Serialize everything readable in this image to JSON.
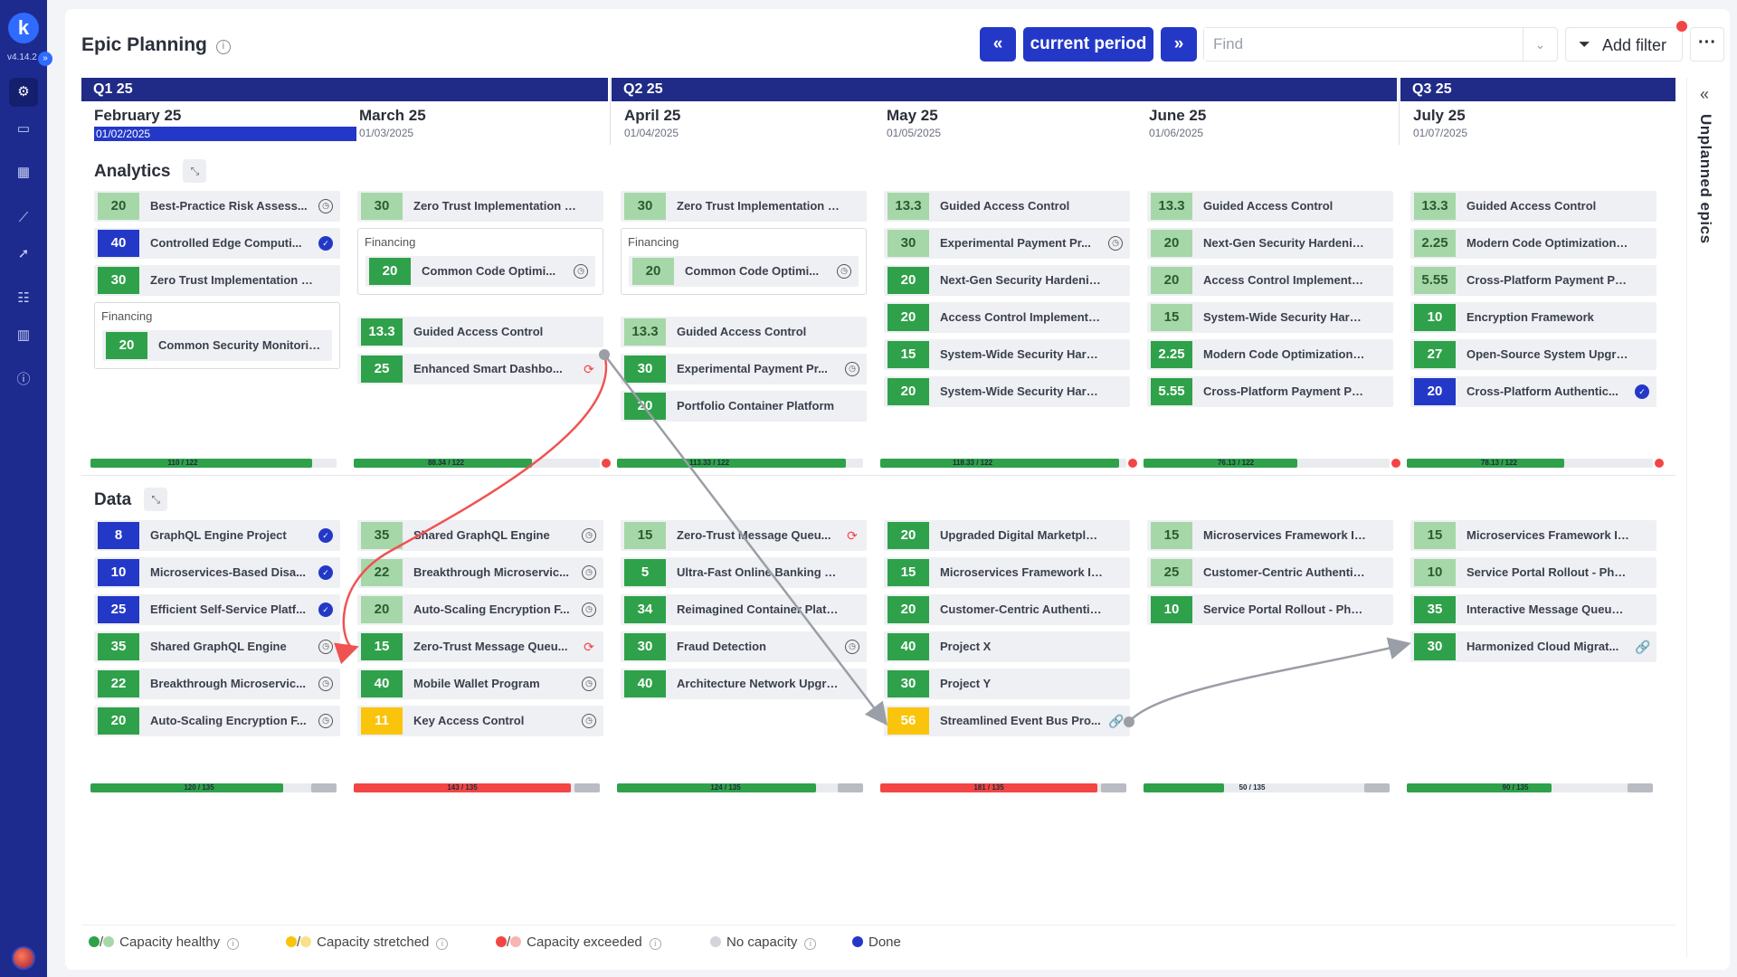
{
  "nav": {
    "logo": "k",
    "version": "v4.14.2",
    "collapse": "»",
    "items": [
      {
        "icon": "roadmap-icon"
      },
      {
        "icon": "briefcase-icon"
      },
      {
        "icon": "calendar-icon"
      },
      {
        "icon": "chart-icon"
      },
      {
        "icon": "rocket-icon"
      },
      {
        "icon": "team-icon"
      },
      {
        "icon": "building-icon"
      },
      {
        "icon": "info-icon"
      }
    ]
  },
  "header": {
    "title": "Epic Planning",
    "prev": "«",
    "current": "current period",
    "next": "»",
    "find_placeholder": "Find",
    "add_filter": "Add filter",
    "more": "···"
  },
  "quarters": [
    {
      "label": "Q1 25"
    },
    {
      "label": "Q2 25"
    },
    {
      "label": "Q3 25"
    }
  ],
  "months": [
    {
      "name": "February 25",
      "date": "01/02/2025",
      "current": true
    },
    {
      "name": "March 25",
      "date": "01/03/2025"
    },
    {
      "name": "April 25",
      "date": "01/04/2025"
    },
    {
      "name": "May 25",
      "date": "01/05/2025"
    },
    {
      "name": "June 25",
      "date": "01/06/2025"
    },
    {
      "name": "July 25",
      "date": "01/07/2025"
    }
  ],
  "sections": [
    {
      "title": "Analytics",
      "columns": [
        {
          "items": [
            {
              "pts": "20",
              "name": "Best-Practice Risk Assess...",
              "color": "lgreen",
              "icon": "clock"
            },
            {
              "pts": "40",
              "name": "Controlled Edge Computi...",
              "color": "blue",
              "icon": "done"
            },
            {
              "pts": "30",
              "name": "Zero Trust Implementation Roll...",
              "color": "green",
              "icon": ""
            },
            {
              "group": "Financing",
              "pts": "20",
              "name": "Common Security Monitoring",
              "color": "green",
              "icon": ""
            }
          ],
          "capacity": {
            "label": "110 / 122",
            "used": 110,
            "total": 122,
            "state": "healthy"
          }
        },
        {
          "items": [
            {
              "pts": "30",
              "name": "Zero Trust Implementation Roll...",
              "color": "lgreen",
              "icon": ""
            },
            {
              "group": "Financing",
              "pts": "20",
              "name": "Common Code Optimi...",
              "color": "green",
              "icon": "clock"
            },
            {
              "pts": "13.3",
              "name": "Guided Access Control",
              "color": "green",
              "icon": ""
            },
            {
              "pts": "25",
              "name": "Enhanced Smart Dashbo...",
              "color": "green",
              "icon": "cycle"
            }
          ],
          "capacity": {
            "label": "88.34 / 122",
            "used": 88.34,
            "total": 122,
            "state": "healthy",
            "alert": true
          }
        },
        {
          "items": [
            {
              "pts": "30",
              "name": "Zero Trust Implementation Roll...",
              "color": "lgreen",
              "icon": ""
            },
            {
              "group": "Financing",
              "pts": "20",
              "name": "Common Code Optimi...",
              "color": "lgreen",
              "icon": "clock"
            },
            {
              "pts": "13.3",
              "name": "Guided Access Control",
              "color": "lgreen",
              "icon": ""
            },
            {
              "pts": "30",
              "name": "Experimental Payment Pr...",
              "color": "green",
              "icon": "clock"
            },
            {
              "pts": "20",
              "name": "Portfolio Container Platform",
              "color": "green",
              "icon": ""
            }
          ],
          "capacity": {
            "label": "113.33 / 122",
            "used": 113.33,
            "total": 122,
            "state": "healthy"
          }
        },
        {
          "items": [
            {
              "pts": "13.3",
              "name": "Guided Access Control",
              "color": "lgreen",
              "icon": ""
            },
            {
              "pts": "30",
              "name": "Experimental Payment Pr...",
              "color": "lgreen",
              "icon": "clock"
            },
            {
              "pts": "20",
              "name": "Next-Gen Security Hardening ...",
              "color": "green",
              "icon": ""
            },
            {
              "pts": "20",
              "name": "Access Control Implementation",
              "color": "green",
              "icon": ""
            },
            {
              "pts": "15",
              "name": "System-Wide Security Hardeni...",
              "color": "green",
              "icon": ""
            },
            {
              "pts": "20",
              "name": "System-Wide Security Hardeni...",
              "color": "green",
              "icon": ""
            }
          ],
          "capacity": {
            "label": "118.33 / 122",
            "used": 118.33,
            "total": 122,
            "state": "healthy",
            "alert": true
          }
        },
        {
          "items": [
            {
              "pts": "13.3",
              "name": "Guided Access Control",
              "color": "lgreen",
              "icon": ""
            },
            {
              "pts": "20",
              "name": "Next-Gen Security Hardening ...",
              "color": "lgreen",
              "icon": ""
            },
            {
              "pts": "20",
              "name": "Access Control Implementation",
              "color": "lgreen",
              "icon": ""
            },
            {
              "pts": "15",
              "name": "System-Wide Security Hardeni...",
              "color": "lgreen",
              "icon": ""
            },
            {
              "pts": "2.25",
              "name": "Modern Code Optimization Fr...",
              "color": "green",
              "icon": ""
            },
            {
              "pts": "5.55",
              "name": "Cross-Platform Payment Proce...",
              "color": "green",
              "icon": ""
            }
          ],
          "capacity": {
            "label": "76.13 / 122",
            "used": 76.13,
            "total": 122,
            "state": "healthy",
            "alert": true
          }
        },
        {
          "items": [
            {
              "pts": "13.3",
              "name": "Guided Access Control",
              "color": "lgreen",
              "icon": ""
            },
            {
              "pts": "2.25",
              "name": "Modern Code Optimization Fr...",
              "color": "lgreen",
              "icon": ""
            },
            {
              "pts": "5.55",
              "name": "Cross-Platform Payment Proce...",
              "color": "lgreen",
              "icon": ""
            },
            {
              "pts": "10",
              "name": "Encryption Framework",
              "color": "green",
              "icon": ""
            },
            {
              "pts": "27",
              "name": "Open-Source System Upgrade",
              "color": "green",
              "icon": ""
            },
            {
              "pts": "20",
              "name": "Cross-Platform Authentic...",
              "color": "blue",
              "icon": "done"
            }
          ],
          "capacity": {
            "label": "78.13 / 122",
            "used": 78.13,
            "total": 122,
            "state": "healthy",
            "alert": true
          }
        }
      ]
    },
    {
      "title": "Data",
      "columns": [
        {
          "items": [
            {
              "pts": "8",
              "name": "GraphQL Engine Project",
              "color": "blue",
              "icon": "done"
            },
            {
              "pts": "10",
              "name": "Microservices-Based Disa...",
              "color": "blue",
              "icon": "done"
            },
            {
              "pts": "25",
              "name": "Efficient Self-Service Platf...",
              "color": "blue",
              "icon": "done"
            },
            {
              "pts": "35",
              "name": "Shared GraphQL Engine",
              "color": "green",
              "icon": "clock"
            },
            {
              "pts": "22",
              "name": "Breakthrough Microservic...",
              "color": "green",
              "icon": "clock"
            },
            {
              "pts": "20",
              "name": "Auto-Scaling Encryption F...",
              "color": "green",
              "icon": "clock"
            }
          ],
          "capacity": {
            "label": "120 / 135",
            "used": 120,
            "total": 135,
            "state": "healthy",
            "grey": true
          }
        },
        {
          "items": [
            {
              "pts": "35",
              "name": "Shared GraphQL Engine",
              "color": "lgreen",
              "icon": "clock"
            },
            {
              "pts": "22",
              "name": "Breakthrough Microservic...",
              "color": "lgreen",
              "icon": "clock"
            },
            {
              "pts": "20",
              "name": "Auto-Scaling Encryption F...",
              "color": "lgreen",
              "icon": "clock"
            },
            {
              "pts": "15",
              "name": "Zero-Trust Message Queu...",
              "color": "green",
              "icon": "cycle"
            },
            {
              "pts": "40",
              "name": "Mobile Wallet Program",
              "color": "green",
              "icon": "clock"
            },
            {
              "pts": "11",
              "name": "Key Access Control",
              "color": "yellow",
              "icon": "clock"
            }
          ],
          "capacity": {
            "label": "143 / 135",
            "used": 143,
            "total": 135,
            "state": "exceeded",
            "grey": true
          }
        },
        {
          "items": [
            {
              "pts": "15",
              "name": "Zero-Trust Message Queu...",
              "color": "lgreen",
              "icon": "cycle"
            },
            {
              "pts": "5",
              "name": "Ultra-Fast Online Banking Hub ...",
              "color": "green",
              "icon": ""
            },
            {
              "pts": "34",
              "name": "Reimagined Container Platfor...",
              "color": "green",
              "icon": ""
            },
            {
              "pts": "30",
              "name": "Fraud Detection",
              "color": "green",
              "icon": "clock"
            },
            {
              "pts": "40",
              "name": "Architecture Network Upgrad...",
              "color": "green",
              "icon": ""
            }
          ],
          "capacity": {
            "label": "124 / 135",
            "used": 124,
            "total": 135,
            "state": "healthy",
            "grey": true
          }
        },
        {
          "items": [
            {
              "pts": "20",
              "name": "Upgraded Digital Marketplac...",
              "color": "green",
              "icon": ""
            },
            {
              "pts": "15",
              "name": "Microservices Framework Initi...",
              "color": "green",
              "icon": ""
            },
            {
              "pts": "20",
              "name": "Customer-Centric Authenticat...",
              "color": "green",
              "icon": ""
            },
            {
              "pts": "40",
              "name": "Project X",
              "color": "green",
              "icon": ""
            },
            {
              "pts": "30",
              "name": "Project Y",
              "color": "green",
              "icon": ""
            },
            {
              "pts": "56",
              "name": "Streamlined Event Bus Pro...",
              "color": "yellow",
              "icon": "link"
            }
          ],
          "capacity": {
            "label": "181 / 135",
            "used": 181,
            "total": 135,
            "state": "exceeded",
            "grey": true
          }
        },
        {
          "items": [
            {
              "pts": "15",
              "name": "Microservices Framework Initi...",
              "color": "lgreen",
              "icon": ""
            },
            {
              "pts": "25",
              "name": "Customer-Centric Authenticat...",
              "color": "lgreen",
              "icon": ""
            },
            {
              "pts": "10",
              "name": "Service Portal Rollout - Phase 1",
              "color": "green",
              "icon": ""
            }
          ],
          "capacity": {
            "label": "50 / 135",
            "used": 50,
            "total": 135,
            "state": "healthy",
            "grey": true
          }
        },
        {
          "items": [
            {
              "pts": "15",
              "name": "Microservices Framework Initi...",
              "color": "lgreen",
              "icon": ""
            },
            {
              "pts": "10",
              "name": "Service Portal Rollout - Phase 1",
              "color": "lgreen",
              "icon": ""
            },
            {
              "pts": "35",
              "name": "Interactive Message Queue Pr...",
              "color": "green",
              "icon": ""
            },
            {
              "pts": "30",
              "name": "Harmonized Cloud Migrat...",
              "color": "green",
              "icon": "link"
            }
          ],
          "capacity": {
            "label": "90 / 135",
            "used": 90,
            "total": 135,
            "state": "healthy",
            "grey": true
          }
        }
      ]
    }
  ],
  "right_panel": {
    "label": "Unplanned epics",
    "chevron": "«"
  },
  "legend": [
    {
      "label": "Capacity healthy",
      "colors": [
        "#2fa14a",
        "#a6d7a8"
      ]
    },
    {
      "label": "Capacity stretched",
      "colors": [
        "#f9c40b",
        "#fbe08a"
      ]
    },
    {
      "label": "Capacity exceeded",
      "colors": [
        "#f44545",
        "#f9b3b3"
      ]
    },
    {
      "label": "No capacity",
      "colors": [
        "#d3d5da"
      ]
    },
    {
      "label": "Done",
      "colors": [
        "#2438c8"
      ]
    }
  ],
  "colors": {
    "green": "#2fa14a",
    "lgreen": "#a6d7a8",
    "blue": "#2438c8",
    "yellow": "#f9c40b",
    "red": "#f44545",
    "navy": "#1f2b87"
  }
}
